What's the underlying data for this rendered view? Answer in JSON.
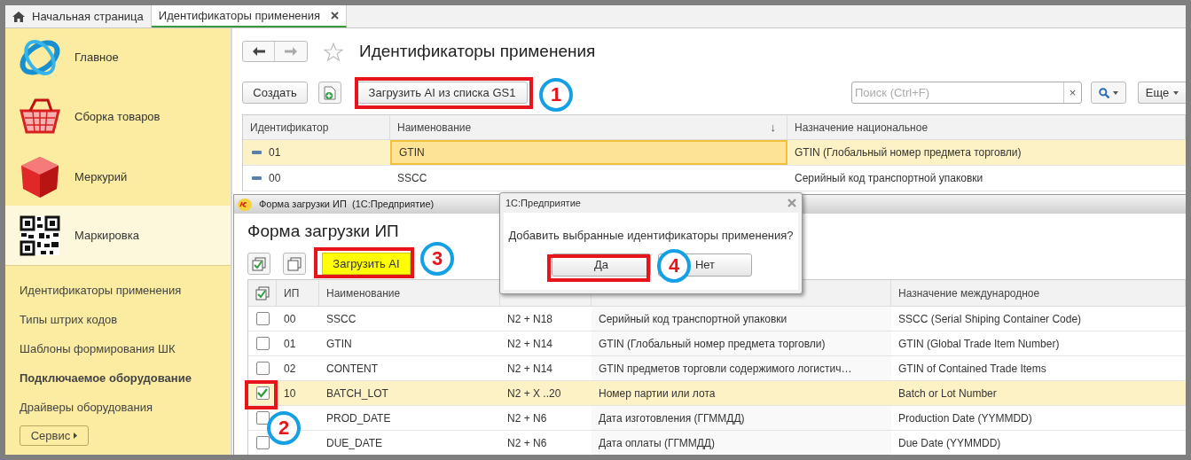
{
  "tabs": [
    {
      "label": "Начальная страница",
      "kind": "home",
      "selected": false
    },
    {
      "label": "Идентификаторы применения",
      "kind": "closable",
      "selected": true
    }
  ],
  "sidebar": {
    "sections": [
      {
        "label": "Главное",
        "kind": "orbit",
        "selected": false
      },
      {
        "label": "Сборка товаров",
        "kind": "basket",
        "selected": false
      },
      {
        "label": "Меркурий",
        "kind": "cube",
        "selected": false
      },
      {
        "label": "Маркировка",
        "kind": "qr",
        "selected": true
      }
    ],
    "links": [
      {
        "label": "Идентификаторы применения",
        "bold": false
      },
      {
        "label": "Типы штрих кодов",
        "bold": false
      },
      {
        "label": "Шаблоны формирования ШК",
        "bold": false
      },
      {
        "label": "Подключаемое оборудование",
        "bold": true
      },
      {
        "label": "Драйверы оборудования",
        "bold": false
      }
    ],
    "service_button": "Сервис"
  },
  "main": {
    "title": "Идентификаторы применения",
    "create_button": "Создать",
    "load_button": "Загрузить AI из списка GS1",
    "search_placeholder": "Поиск (Ctrl+F)",
    "clear_button": "×",
    "more_button": "Еще",
    "columns": [
      {
        "label": "Идентификатор"
      },
      {
        "label": "Наименование",
        "sort": "↓"
      },
      {
        "label": "Назначение национальное"
      }
    ],
    "rows": [
      {
        "id": "01",
        "name": "GTIN",
        "national": "GTIN (Глобальный номер предмета торговли)",
        "selected": true
      },
      {
        "id": "00",
        "name": "SSCC",
        "national": "Серийный код транспортной упаковки",
        "selected": false
      }
    ]
  },
  "load_form": {
    "window_title": "Форма загрузки ИП  (1С:Предприятие)",
    "title": "Форма загрузки ИП",
    "load_button": "Загрузить AI",
    "columns": [
      {
        "label": "ИП"
      },
      {
        "label": "Наименование"
      },
      {
        "label": "Назначение международное"
      }
    ],
    "rows": [
      {
        "checked": false,
        "selected": false,
        "ip": "00",
        "name": "SSCC",
        "format": "N2 + N18",
        "description": "Серийный код транспортной упаковки",
        "international": "SSCC (Serial Shiping Container Code)"
      },
      {
        "checked": false,
        "selected": false,
        "ip": "01",
        "name": "GTIN",
        "format": "N2 + N14",
        "description": "GTIN (Глобальный номер предмета торговли)",
        "international": "GTIN (Global Trade Item Number)"
      },
      {
        "checked": false,
        "selected": false,
        "ip": "02",
        "name": "CONTENT",
        "format": "N2 + N14",
        "description": "GTIN предметов торговли содержимого логистич…",
        "international": "GTIN of Contained Trade Items"
      },
      {
        "checked": true,
        "selected": true,
        "ip": "10",
        "name": "BATCH_LOT",
        "format": "N2 + X ..20",
        "description": "Номер партии или лота",
        "international": "Batch or Lot Number"
      },
      {
        "checked": false,
        "selected": false,
        "name": "PROD_DATE",
        "format": "N2 + N6",
        "description": "Дата изготовления (ГГММДД)",
        "international": "Production Date (YYMMDD)"
      },
      {
        "checked": false,
        "selected": false,
        "name": "DUE_DATE",
        "format": "N2 + N6",
        "description": "Дата оплаты (ГГММДД)",
        "international": "Due Date (YYMMDD)"
      }
    ]
  },
  "dialog": {
    "title": "1С:Предприятие",
    "message": "Добавить выбранные идентификаторы применения?",
    "buttons": [
      {
        "label": "Да"
      },
      {
        "label": "Нет"
      }
    ]
  },
  "step_markers": [
    {
      "label": "1"
    },
    {
      "label": "2"
    },
    {
      "label": "3"
    },
    {
      "label": "4"
    }
  ]
}
